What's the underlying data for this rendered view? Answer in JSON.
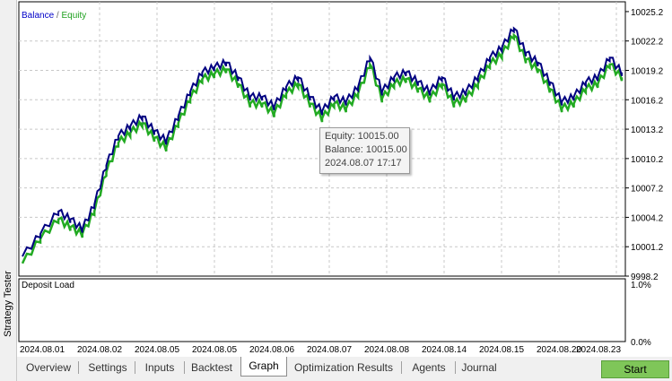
{
  "side_title": "Strategy Tester",
  "legend": {
    "balance": "Balance",
    "separator": " / ",
    "equity": "Equity"
  },
  "colors": {
    "balance": "#000080",
    "equity": "#22aa22",
    "grid": "#c8c8c8",
    "start_button": "#7fc659"
  },
  "tooltip": {
    "equity": "Equity: 10015.00",
    "balance": "Balance: 10015.00",
    "time": "2024.08.07 17:17"
  },
  "deposit_load": {
    "label": "Deposit Load",
    "max_label": "1.0%",
    "min_label": "0.0%"
  },
  "tabs": [
    {
      "label": "Overview",
      "active": false
    },
    {
      "label": "Settings",
      "active": false
    },
    {
      "label": "Inputs",
      "active": false
    },
    {
      "label": "Backtest",
      "active": false
    },
    {
      "label": "Graph",
      "active": true
    },
    {
      "label": "Optimization Results",
      "active": false
    },
    {
      "label": "Agents",
      "active": false
    },
    {
      "label": "Journal",
      "active": false
    }
  ],
  "start_button": "Start",
  "chart_data": {
    "type": "line",
    "title": "",
    "legend": [
      "Balance",
      "Equity"
    ],
    "y_ticks": [
      "10025.2",
      "10022.2",
      "10019.2",
      "10016.2",
      "10013.2",
      "10010.2",
      "10007.2",
      "10004.2",
      "10001.2",
      "9998.2"
    ],
    "ylim": [
      9998.2,
      10026.2
    ],
    "x_ticks": [
      "2024.08.01",
      "2024.08.02",
      "2024.08.05",
      "2024.08.05",
      "2024.08.06",
      "2024.08.07",
      "2024.08.08",
      "2024.08.14",
      "2024.08.15",
      "2024.08.20",
      "2024.08.23"
    ],
    "grid": true,
    "series": [
      {
        "name": "Balance",
        "x": [
          0,
          0.03,
          0.06,
          0.08,
          0.1,
          0.12,
          0.14,
          0.16,
          0.18,
          0.2,
          0.22,
          0.24,
          0.26,
          0.28,
          0.3,
          0.32,
          0.34,
          0.36,
          0.38,
          0.4,
          0.42,
          0.44,
          0.46,
          0.48,
          0.5,
          0.52,
          0.54,
          0.56,
          0.58,
          0.6,
          0.62,
          0.64,
          0.66,
          0.68,
          0.7,
          0.72,
          0.74,
          0.76,
          0.78,
          0.8,
          0.82,
          0.84,
          0.86,
          0.88,
          0.9,
          0.92,
          0.94,
          0.96,
          0.98,
          1.0
        ],
        "values": [
          10000.2,
          10002.5,
          10004.8,
          10004.0,
          10003.0,
          10005.5,
          10009.5,
          10012.5,
          10013.5,
          10014.5,
          10013.0,
          10012.0,
          10014.5,
          10017.0,
          10019.0,
          10019.5,
          10020.0,
          10018.5,
          10016.5,
          10016.5,
          10015.5,
          10017.5,
          10018.5,
          10016.5,
          10015.0,
          10016.5,
          10016.0,
          10017.5,
          10020.5,
          10017.0,
          10018.5,
          10019.0,
          10018.0,
          10017.0,
          10018.5,
          10016.5,
          10017.0,
          10018.5,
          10020.5,
          10021.5,
          10023.5,
          10021.0,
          10020.0,
          10018.0,
          10016.0,
          10016.5,
          10018.0,
          10018.5,
          10020.5,
          10019.0
        ]
      },
      {
        "name": "Equity",
        "x": [
          0,
          0.03,
          0.06,
          0.08,
          0.1,
          0.12,
          0.14,
          0.16,
          0.18,
          0.2,
          0.22,
          0.24,
          0.26,
          0.28,
          0.3,
          0.32,
          0.34,
          0.36,
          0.38,
          0.4,
          0.42,
          0.44,
          0.46,
          0.48,
          0.5,
          0.52,
          0.54,
          0.56,
          0.58,
          0.6,
          0.62,
          0.64,
          0.66,
          0.68,
          0.7,
          0.72,
          0.74,
          0.76,
          0.78,
          0.8,
          0.82,
          0.84,
          0.86,
          0.88,
          0.9,
          0.92,
          0.94,
          0.96,
          0.98,
          1.0
        ],
        "values": [
          9999.5,
          10002.0,
          10004.0,
          10003.2,
          10002.5,
          10004.8,
          10008.8,
          10011.8,
          10012.8,
          10013.8,
          10012.3,
          10011.3,
          10013.8,
          10016.3,
          10018.3,
          10018.8,
          10019.3,
          10017.8,
          10015.8,
          10015.8,
          10014.8,
          10016.8,
          10017.8,
          10015.8,
          10014.3,
          10015.8,
          10015.3,
          10016.8,
          10019.8,
          10016.3,
          10017.8,
          10018.3,
          10017.3,
          10016.3,
          10017.8,
          10015.8,
          10016.3,
          10017.8,
          10019.8,
          10020.8,
          10022.8,
          10020.3,
          10019.3,
          10017.3,
          10015.3,
          10015.8,
          10017.3,
          10017.8,
          10019.8,
          10018.5
        ]
      }
    ]
  }
}
